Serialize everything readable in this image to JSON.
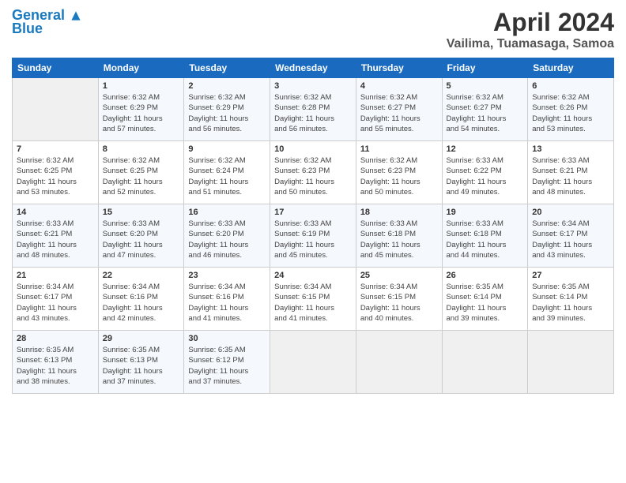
{
  "header": {
    "logo_line1": "General",
    "logo_line2": "Blue",
    "month": "April 2024",
    "location": "Vailima, Tuamasaga, Samoa"
  },
  "days_of_week": [
    "Sunday",
    "Monday",
    "Tuesday",
    "Wednesday",
    "Thursday",
    "Friday",
    "Saturday"
  ],
  "weeks": [
    [
      {
        "day": "",
        "info": ""
      },
      {
        "day": "1",
        "info": "Sunrise: 6:32 AM\nSunset: 6:29 PM\nDaylight: 11 hours\nand 57 minutes."
      },
      {
        "day": "2",
        "info": "Sunrise: 6:32 AM\nSunset: 6:29 PM\nDaylight: 11 hours\nand 56 minutes."
      },
      {
        "day": "3",
        "info": "Sunrise: 6:32 AM\nSunset: 6:28 PM\nDaylight: 11 hours\nand 56 minutes."
      },
      {
        "day": "4",
        "info": "Sunrise: 6:32 AM\nSunset: 6:27 PM\nDaylight: 11 hours\nand 55 minutes."
      },
      {
        "day": "5",
        "info": "Sunrise: 6:32 AM\nSunset: 6:27 PM\nDaylight: 11 hours\nand 54 minutes."
      },
      {
        "day": "6",
        "info": "Sunrise: 6:32 AM\nSunset: 6:26 PM\nDaylight: 11 hours\nand 53 minutes."
      }
    ],
    [
      {
        "day": "7",
        "info": "Sunrise: 6:32 AM\nSunset: 6:25 PM\nDaylight: 11 hours\nand 53 minutes."
      },
      {
        "day": "8",
        "info": "Sunrise: 6:32 AM\nSunset: 6:25 PM\nDaylight: 11 hours\nand 52 minutes."
      },
      {
        "day": "9",
        "info": "Sunrise: 6:32 AM\nSunset: 6:24 PM\nDaylight: 11 hours\nand 51 minutes."
      },
      {
        "day": "10",
        "info": "Sunrise: 6:32 AM\nSunset: 6:23 PM\nDaylight: 11 hours\nand 50 minutes."
      },
      {
        "day": "11",
        "info": "Sunrise: 6:32 AM\nSunset: 6:23 PM\nDaylight: 11 hours\nand 50 minutes."
      },
      {
        "day": "12",
        "info": "Sunrise: 6:33 AM\nSunset: 6:22 PM\nDaylight: 11 hours\nand 49 minutes."
      },
      {
        "day": "13",
        "info": "Sunrise: 6:33 AM\nSunset: 6:21 PM\nDaylight: 11 hours\nand 48 minutes."
      }
    ],
    [
      {
        "day": "14",
        "info": "Sunrise: 6:33 AM\nSunset: 6:21 PM\nDaylight: 11 hours\nand 48 minutes."
      },
      {
        "day": "15",
        "info": "Sunrise: 6:33 AM\nSunset: 6:20 PM\nDaylight: 11 hours\nand 47 minutes."
      },
      {
        "day": "16",
        "info": "Sunrise: 6:33 AM\nSunset: 6:20 PM\nDaylight: 11 hours\nand 46 minutes."
      },
      {
        "day": "17",
        "info": "Sunrise: 6:33 AM\nSunset: 6:19 PM\nDaylight: 11 hours\nand 45 minutes."
      },
      {
        "day": "18",
        "info": "Sunrise: 6:33 AM\nSunset: 6:18 PM\nDaylight: 11 hours\nand 45 minutes."
      },
      {
        "day": "19",
        "info": "Sunrise: 6:33 AM\nSunset: 6:18 PM\nDaylight: 11 hours\nand 44 minutes."
      },
      {
        "day": "20",
        "info": "Sunrise: 6:34 AM\nSunset: 6:17 PM\nDaylight: 11 hours\nand 43 minutes."
      }
    ],
    [
      {
        "day": "21",
        "info": "Sunrise: 6:34 AM\nSunset: 6:17 PM\nDaylight: 11 hours\nand 43 minutes."
      },
      {
        "day": "22",
        "info": "Sunrise: 6:34 AM\nSunset: 6:16 PM\nDaylight: 11 hours\nand 42 minutes."
      },
      {
        "day": "23",
        "info": "Sunrise: 6:34 AM\nSunset: 6:16 PM\nDaylight: 11 hours\nand 41 minutes."
      },
      {
        "day": "24",
        "info": "Sunrise: 6:34 AM\nSunset: 6:15 PM\nDaylight: 11 hours\nand 41 minutes."
      },
      {
        "day": "25",
        "info": "Sunrise: 6:34 AM\nSunset: 6:15 PM\nDaylight: 11 hours\nand 40 minutes."
      },
      {
        "day": "26",
        "info": "Sunrise: 6:35 AM\nSunset: 6:14 PM\nDaylight: 11 hours\nand 39 minutes."
      },
      {
        "day": "27",
        "info": "Sunrise: 6:35 AM\nSunset: 6:14 PM\nDaylight: 11 hours\nand 39 minutes."
      }
    ],
    [
      {
        "day": "28",
        "info": "Sunrise: 6:35 AM\nSunset: 6:13 PM\nDaylight: 11 hours\nand 38 minutes."
      },
      {
        "day": "29",
        "info": "Sunrise: 6:35 AM\nSunset: 6:13 PM\nDaylight: 11 hours\nand 37 minutes."
      },
      {
        "day": "30",
        "info": "Sunrise: 6:35 AM\nSunset: 6:12 PM\nDaylight: 11 hours\nand 37 minutes."
      },
      {
        "day": "",
        "info": ""
      },
      {
        "day": "",
        "info": ""
      },
      {
        "day": "",
        "info": ""
      },
      {
        "day": "",
        "info": ""
      }
    ]
  ]
}
